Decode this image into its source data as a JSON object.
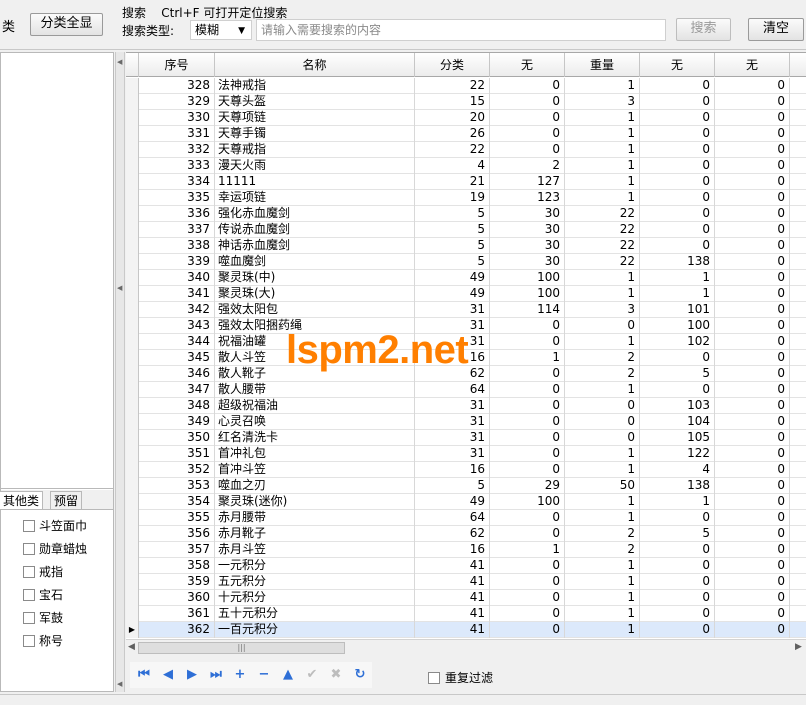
{
  "toolbar": {
    "left_fragment": "类",
    "show_all_label": "分类全显",
    "search_caption": "搜索    Ctrl+F 可打开定位搜索",
    "search_type_label": "搜索类型:",
    "search_type_value": "模糊",
    "search_placeholder": "请输入需要搜索的内容",
    "search_button": "搜索",
    "clear_button": "清空"
  },
  "left_panel": {
    "tabs": [
      "其他类",
      "预留"
    ],
    "categories": [
      "斗笠面巾",
      "勋章蜡烛",
      "戒指",
      "宝石",
      "军鼓",
      "称号"
    ]
  },
  "grid": {
    "columns": [
      "序号",
      "名称",
      "分类",
      "无",
      "重量",
      "无",
      "无"
    ],
    "selected_row_index": 34,
    "rows": [
      [
        "328",
        "法神戒指",
        "22",
        "0",
        "1",
        "0",
        "0"
      ],
      [
        "329",
        "天尊头盔",
        "15",
        "0",
        "3",
        "0",
        "0"
      ],
      [
        "330",
        "天尊项链",
        "20",
        "0",
        "1",
        "0",
        "0"
      ],
      [
        "331",
        "天尊手镯",
        "26",
        "0",
        "1",
        "0",
        "0"
      ],
      [
        "332",
        "天尊戒指",
        "22",
        "0",
        "1",
        "0",
        "0"
      ],
      [
        "333",
        "漫天火雨",
        "4",
        "2",
        "1",
        "0",
        "0"
      ],
      [
        "334",
        "11111",
        "21",
        "127",
        "1",
        "0",
        "0"
      ],
      [
        "335",
        "幸运项链",
        "19",
        "123",
        "1",
        "0",
        "0"
      ],
      [
        "336",
        "强化赤血魔剑",
        "5",
        "30",
        "22",
        "0",
        "0"
      ],
      [
        "337",
        "传说赤血魔剑",
        "5",
        "30",
        "22",
        "0",
        "0"
      ],
      [
        "338",
        "神话赤血魔剑",
        "5",
        "30",
        "22",
        "0",
        "0"
      ],
      [
        "339",
        "噬血魔剑",
        "5",
        "30",
        "22",
        "138",
        "0"
      ],
      [
        "340",
        "聚灵珠(中)",
        "49",
        "100",
        "1",
        "1",
        "0"
      ],
      [
        "341",
        "聚灵珠(大)",
        "49",
        "100",
        "1",
        "1",
        "0"
      ],
      [
        "342",
        "强效太阳包",
        "31",
        "114",
        "3",
        "101",
        "0"
      ],
      [
        "343",
        "强效太阳捆药绳",
        "31",
        "0",
        "0",
        "100",
        "0"
      ],
      [
        "344",
        "祝福油罐",
        "31",
        "0",
        "1",
        "102",
        "0"
      ],
      [
        "345",
        "散人斗笠",
        "16",
        "1",
        "2",
        "0",
        "0"
      ],
      [
        "346",
        "散人靴子",
        "62",
        "0",
        "2",
        "5",
        "0"
      ],
      [
        "347",
        "散人腰带",
        "64",
        "0",
        "1",
        "0",
        "0"
      ],
      [
        "348",
        "超级祝福油",
        "31",
        "0",
        "0",
        "103",
        "0"
      ],
      [
        "349",
        "心灵召唤",
        "31",
        "0",
        "0",
        "104",
        "0"
      ],
      [
        "350",
        "红名清洗卡",
        "31",
        "0",
        "0",
        "105",
        "0"
      ],
      [
        "351",
        "首冲礼包",
        "31",
        "0",
        "1",
        "122",
        "0"
      ],
      [
        "352",
        "首冲斗笠",
        "16",
        "0",
        "1",
        "4",
        "0"
      ],
      [
        "353",
        "噬血之刃",
        "5",
        "29",
        "50",
        "138",
        "0"
      ],
      [
        "354",
        "聚灵珠(迷你)",
        "49",
        "100",
        "1",
        "1",
        "0"
      ],
      [
        "355",
        "赤月腰带",
        "64",
        "0",
        "1",
        "0",
        "0"
      ],
      [
        "356",
        "赤月靴子",
        "62",
        "0",
        "2",
        "5",
        "0"
      ],
      [
        "357",
        "赤月斗笠",
        "16",
        "1",
        "2",
        "0",
        "0"
      ],
      [
        "358",
        "一元积分",
        "41",
        "0",
        "1",
        "0",
        "0"
      ],
      [
        "359",
        "五元积分",
        "41",
        "0",
        "1",
        "0",
        "0"
      ],
      [
        "360",
        "十元积分",
        "41",
        "0",
        "1",
        "0",
        "0"
      ],
      [
        "361",
        "五十元积分",
        "41",
        "0",
        "1",
        "0",
        "0"
      ],
      [
        "362",
        "一百元积分",
        "41",
        "0",
        "1",
        "0",
        "0"
      ]
    ]
  },
  "navigator": {
    "buttons": [
      "first-icon",
      "prior-icon",
      "next-icon",
      "last-icon",
      "insert-icon",
      "delete-icon",
      "edit-icon",
      "post-icon",
      "cancel-icon",
      "refresh-icon"
    ],
    "duplicate_filter_label": "重复过滤"
  },
  "watermark": "lspm2.net"
}
